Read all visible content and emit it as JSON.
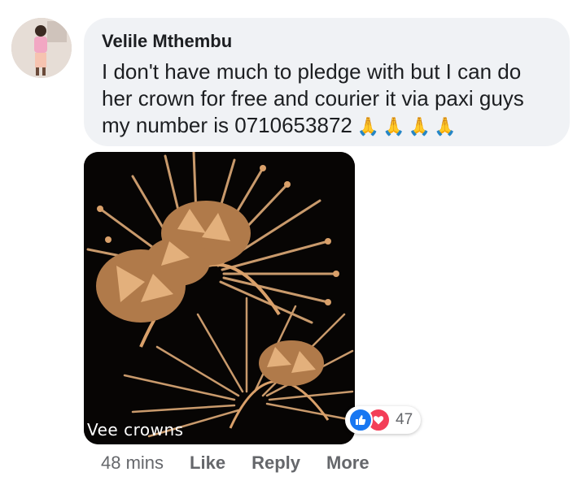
{
  "comment": {
    "author": "Velile Mthembu",
    "text": "I don't have much to pledge with but I can do her crown for free and courier it via paxi guys my number is 0710653872",
    "emoji": "🙏🙏🙏🙏"
  },
  "photo": {
    "watermark": "Vee crowns"
  },
  "reactions": {
    "like_icon": "thumbs-up-icon",
    "love_icon": "heart-icon",
    "count": "47"
  },
  "actions": {
    "time": "48 mins",
    "like": "Like",
    "reply": "Reply",
    "more": "More"
  },
  "colors": {
    "bubble": "#f0f2f5",
    "like_blue": "#1877f2",
    "love_red": "#f33e58",
    "meta_gray": "#65676b",
    "gold": "#b98a5a"
  }
}
